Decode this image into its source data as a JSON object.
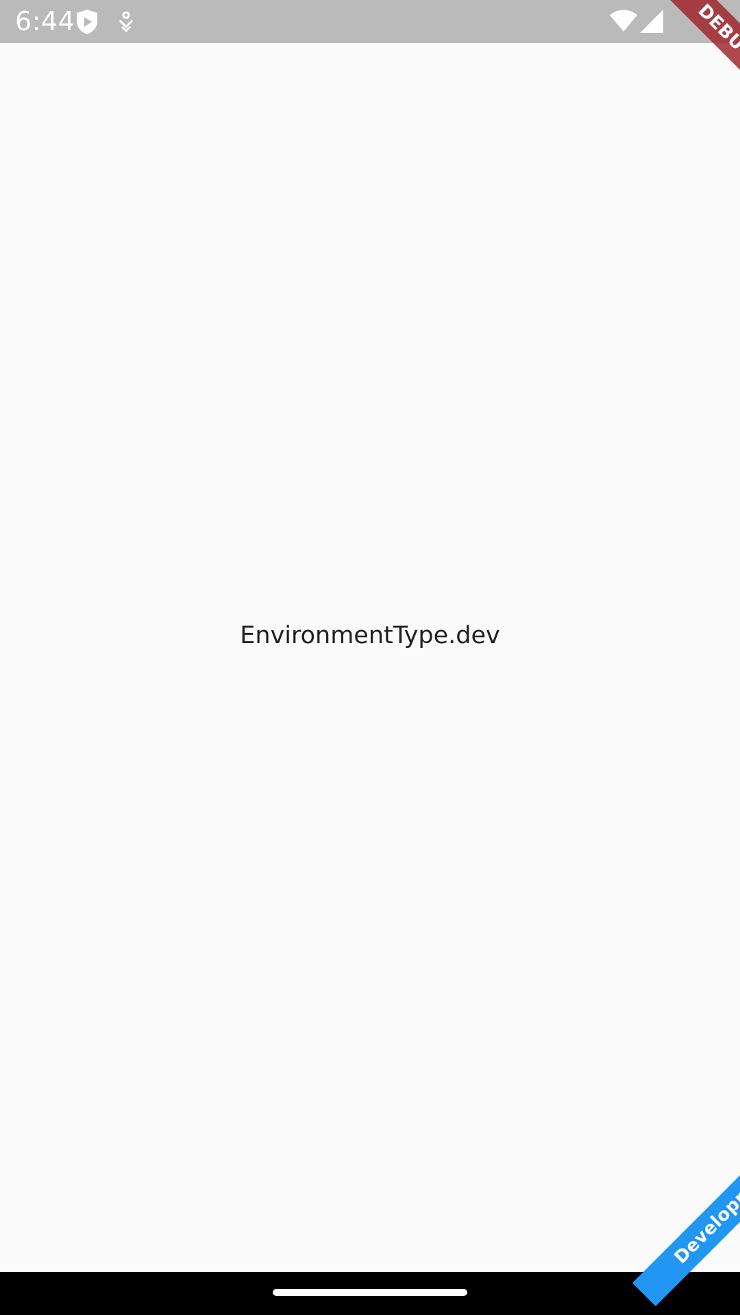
{
  "status_bar": {
    "time": "6:44",
    "icons": [
      "shield-play-icon",
      "accessibility-icon",
      "wifi-icon",
      "cell-signal-icon"
    ]
  },
  "main": {
    "text": "EnvironmentType.dev"
  },
  "banners": {
    "debug": "DEBUG",
    "environment": "Development"
  },
  "colors": {
    "status_bar": "#BABABA",
    "background": "#FAFAFA",
    "text": "#212121",
    "debug_banner": "#A02228",
    "dev_banner": "#2196F3",
    "nav_bar": "#000000"
  }
}
